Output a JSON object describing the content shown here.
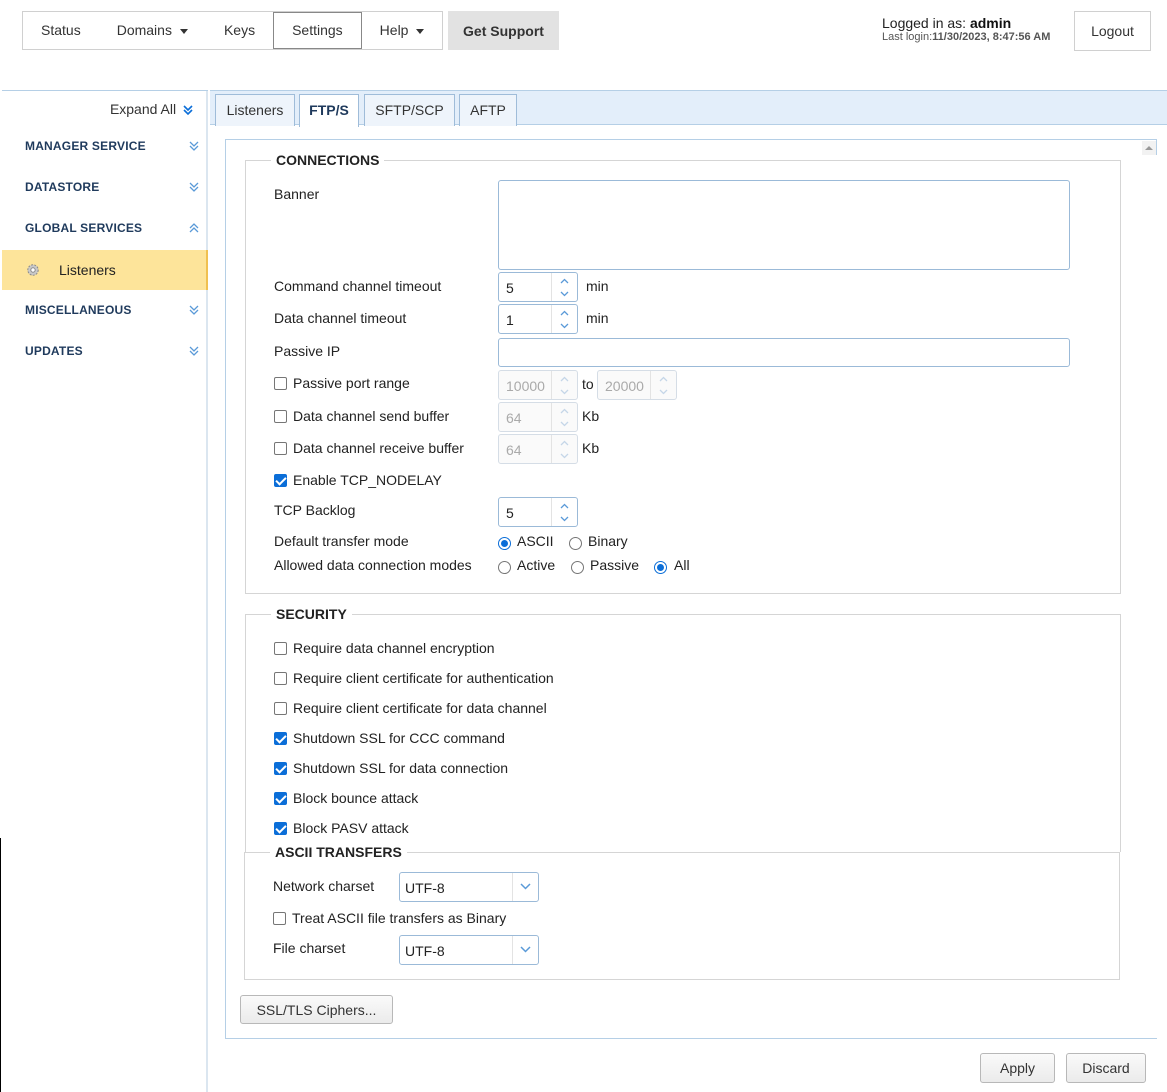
{
  "topnav": {
    "items": [
      {
        "label": "Status"
      },
      {
        "label": "Domains",
        "dropdown": true
      },
      {
        "label": "Keys"
      },
      {
        "label": "Settings",
        "active": true
      },
      {
        "label": "Help",
        "dropdown": true
      }
    ],
    "get_support": "Get Support",
    "login_prefix": "Logged in as:",
    "username": "admin",
    "last_login_label": "Last login:",
    "last_login_value": "11/30/2023, 8:47:56 AM",
    "logout": "Logout"
  },
  "sidebar": {
    "expand_all": "Expand All",
    "sections": [
      {
        "label": "MANAGER SERVICE",
        "expanded": false
      },
      {
        "label": "DATASTORE",
        "expanded": false
      },
      {
        "label": "GLOBAL SERVICES",
        "expanded": true
      },
      {
        "label": "MISCELLANEOUS",
        "expanded": false
      },
      {
        "label": "UPDATES",
        "expanded": false
      }
    ],
    "sub_item": {
      "label": "Listeners",
      "icon": "gear-icon"
    }
  },
  "tabs": [
    {
      "label": "Listeners"
    },
    {
      "label": "FTP/S",
      "active": true
    },
    {
      "label": "SFTP/SCP"
    },
    {
      "label": "AFTP"
    }
  ],
  "connections": {
    "legend": "CONNECTIONS",
    "banner_label": "Banner",
    "banner_value": "",
    "command_timeout_label": "Command channel timeout",
    "command_timeout_value": "5",
    "command_timeout_unit": "min",
    "data_timeout_label": "Data channel timeout",
    "data_timeout_value": "1",
    "data_timeout_unit": "min",
    "passive_ip_label": "Passive IP",
    "passive_ip_value": "",
    "passive_port_range_label": "Passive port range",
    "passive_port_range_checked": false,
    "port_from": "10000",
    "port_to_label": "to",
    "port_to": "20000",
    "send_buffer_label": "Data channel send buffer",
    "send_buffer_checked": false,
    "send_buffer_value": "64",
    "send_buffer_unit": "Kb",
    "recv_buffer_label": "Data channel receive buffer",
    "recv_buffer_checked": false,
    "recv_buffer_value": "64",
    "recv_buffer_unit": "Kb",
    "tcp_nodelay_label": "Enable TCP_NODELAY",
    "tcp_nodelay_checked": true,
    "tcp_backlog_label": "TCP Backlog",
    "tcp_backlog_value": "5",
    "transfer_mode_label": "Default transfer mode",
    "transfer_mode_options": [
      "ASCII",
      "Binary"
    ],
    "transfer_mode_selected": "ASCII",
    "data_modes_label": "Allowed data connection modes",
    "data_modes_options": [
      "Active",
      "Passive",
      "All"
    ],
    "data_modes_selected": "All"
  },
  "security": {
    "legend": "SECURITY",
    "options": [
      {
        "label": "Require data channel encryption",
        "checked": false
      },
      {
        "label": "Require client certificate for authentication",
        "checked": false
      },
      {
        "label": "Require client certificate for data channel",
        "checked": false
      },
      {
        "label": "Shutdown SSL for CCC command",
        "checked": true
      },
      {
        "label": "Shutdown SSL for data connection",
        "checked": true
      },
      {
        "label": "Block bounce attack",
        "checked": true
      },
      {
        "label": "Block PASV attack",
        "checked": true
      }
    ]
  },
  "ascii": {
    "legend": "ASCII TRANSFERS",
    "network_charset_label": "Network charset",
    "network_charset_value": "UTF-8",
    "treat_binary_label": "Treat ASCII file transfers as Binary",
    "treat_binary_checked": false,
    "file_charset_label": "File charset",
    "file_charset_value": "UTF-8"
  },
  "buttons": {
    "ciphers": "SSL/TLS Ciphers...",
    "apply": "Apply",
    "discard": "Discard"
  },
  "colors": {
    "accent": "#0b6ed8",
    "sidebar_text": "#1f3a5c",
    "selected_bg": "#fde49a",
    "tab_bar": "#e3eefa"
  }
}
